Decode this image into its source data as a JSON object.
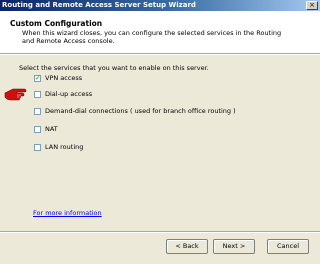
{
  "window": {
    "title": "Routing and Remote Access Server Setup Wizard",
    "close_glyph": "×"
  },
  "header": {
    "title": "Custom Configuration",
    "description": "When this wizard closes, you can configure the selected services in the Routing and Remote Access console."
  },
  "content": {
    "instruction": "Select the services that you want to enable on this server.",
    "options": [
      {
        "label": "VPN access",
        "checked": true
      },
      {
        "label": "Dial-up access",
        "checked": false
      },
      {
        "label": "Demand-dial connections ( used for branch office routing )",
        "checked": false
      },
      {
        "label": "NAT",
        "checked": false
      },
      {
        "label": "LAN routing",
        "checked": false
      }
    ],
    "more_info_link": "For more information",
    "pointer_icon": "hand-pointer-icon"
  },
  "buttons": {
    "back": "< Back",
    "next": "Next >",
    "cancel": "Cancel"
  },
  "colors": {
    "title_bar": "#0a246a",
    "pointer": "#d01010",
    "check": "#21a121",
    "link": "#0000ff"
  }
}
